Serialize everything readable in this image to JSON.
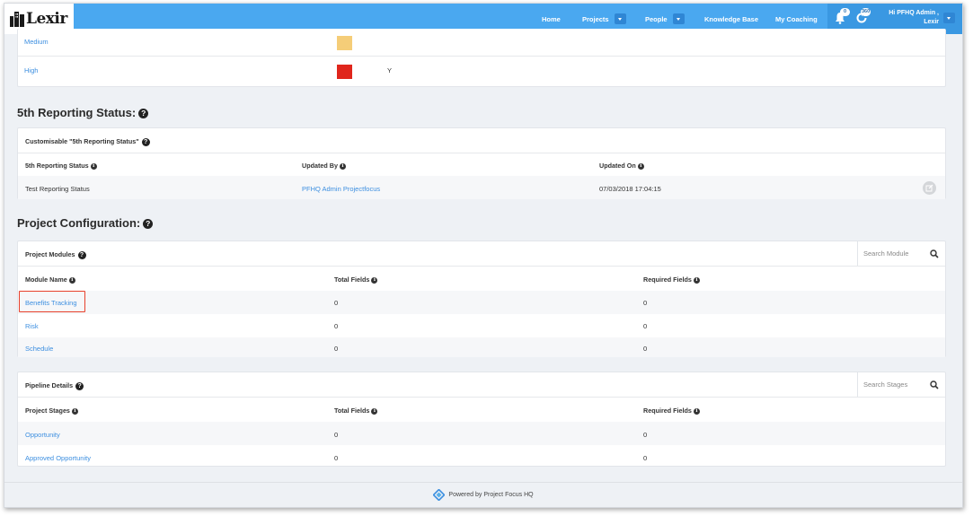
{
  "app": {
    "logo_text": "Lexir"
  },
  "nav": {
    "home": "Home",
    "projects": "Projects",
    "people": "People",
    "knowledge_base": "Knowledge Base",
    "my_coaching": "My Coaching",
    "notifications_count": "0",
    "updates_count": "360",
    "user_line1": "Hi PFHQ Admin ,",
    "user_line2": "Lexir"
  },
  "priority_panel": {
    "rows": [
      {
        "label": "Medium",
        "color": "#f5cd78",
        "value": ""
      },
      {
        "label": "High",
        "color": "#e0261c",
        "value": "Y"
      }
    ]
  },
  "reporting": {
    "section_title": "5th Reporting Status:",
    "panel_title": "Customisable \"5th Reporting Status\"",
    "columns": [
      "5th Reporting Status",
      "Updated By",
      "Updated On"
    ],
    "row": {
      "status": "Test Reporting Status",
      "updated_by": "PFHQ Admin Projectfocus",
      "updated_on": "07/03/2018 17:04:15"
    }
  },
  "configuration": {
    "section_title": "Project Configuration:",
    "modules": {
      "panel_title": "Project Modules",
      "search_placeholder": "Search Module",
      "columns": [
        "Module Name",
        "Total Fields",
        "Required Fields"
      ],
      "rows": [
        {
          "name": "Benefits Tracking",
          "total": "0",
          "required": "0"
        },
        {
          "name": "Risk",
          "total": "0",
          "required": "0"
        },
        {
          "name": "Schedule",
          "total": "0",
          "required": "0"
        }
      ]
    },
    "pipeline": {
      "panel_title": "Pipeline Details",
      "search_placeholder": "Search Stages",
      "columns": [
        "Project Stages",
        "Total Fields",
        "Required Fields"
      ],
      "rows": [
        {
          "name": "Opportunity",
          "total": "0",
          "required": "0"
        },
        {
          "name": "Approved Opportunity",
          "total": "0",
          "required": "0"
        }
      ]
    }
  },
  "footer": {
    "text": "Powered by Project Focus HQ"
  },
  "colors": {
    "topbar": "#4aa8f0",
    "link": "#3d8fe0",
    "highlight": "#e8412c"
  }
}
